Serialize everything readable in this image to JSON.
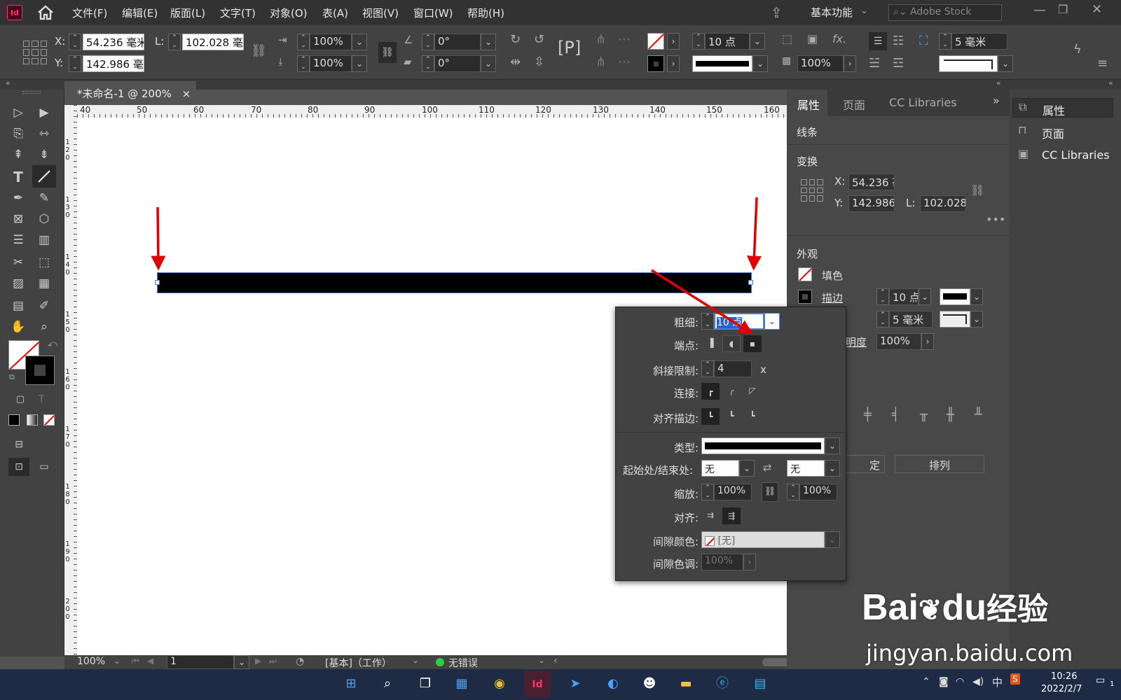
{
  "menubar": {
    "app_icon": "Id",
    "items": [
      "文件(F)",
      "编辑(E)",
      "版面(L)",
      "文字(T)",
      "对象(O)",
      "表(A)",
      "视图(V)",
      "窗口(W)",
      "帮助(H)"
    ],
    "workspace": "基本功能",
    "search_placeholder": "Adobe Stock"
  },
  "control": {
    "x_label": "X:",
    "x_value": "54.236 毫米",
    "y_label": "Y:",
    "y_value": "142.986 毫",
    "l_label": "L:",
    "l_value": "102.028 毫",
    "scale_x": "100%",
    "scale_y": "100%",
    "rotate": "0°",
    "shear": "0°",
    "stroke_weight": "10 点",
    "opacity": "100%",
    "offset": "5 毫米"
  },
  "doc_tab": {
    "title": "*未命名-1 @ 200%",
    "close": "×"
  },
  "ruler": {
    "h_ticks": [
      "40",
      "50",
      "60",
      "70",
      "80",
      "90",
      "100",
      "110",
      "120",
      "130",
      "140",
      "150",
      "160"
    ],
    "v_ticks": [
      "120",
      "130",
      "140",
      "150",
      "160",
      "170",
      "180",
      "190",
      "200"
    ]
  },
  "status": {
    "zoom": "100%",
    "page": "1",
    "style": "[基本]（工作）",
    "preflight": "无错误"
  },
  "props_panel": {
    "tabs": [
      "属性",
      "页面",
      "CC Libraries"
    ],
    "object_type": "线条",
    "transform_title": "变换",
    "x_label": "X:",
    "x_value": "54.236 毫",
    "y_label": "Y:",
    "y_value": "142.986",
    "l_label": "L:",
    "l_value": "102.028",
    "appearance_title": "外观",
    "fill_label": "填色",
    "stroke_label": "描边",
    "stroke_weight": "10 点",
    "offset": "5 毫米",
    "opacity_label_part": "明度",
    "opacity_value": "100%",
    "arrange_button": "排列",
    "partial_button": "定"
  },
  "far_panel": {
    "items": [
      "属性",
      "页面",
      "CC Libraries"
    ]
  },
  "stroke_popup": {
    "weight_label": "粗细:",
    "weight_value": "10 点",
    "cap_label": "端点:",
    "miter_label": "斜接限制:",
    "miter_value": "4",
    "miter_unit": "x",
    "join_label": "连接:",
    "align_label": "对齐描边:",
    "type_label": "类型:",
    "start_end_label": "起始处/结束处:",
    "start_value": "无",
    "end_value": "无",
    "scale_label": "缩放:",
    "scale_start": "100%",
    "scale_end": "100%",
    "arrow_align_label": "对齐:",
    "gap_color_label": "间隙颜色:",
    "gap_color_value": "[无]",
    "gap_tint_label": "间隙色调:",
    "gap_tint_value": "100%"
  },
  "taskbar": {
    "time": "10:26",
    "date": "2022/2/7",
    "ime": "中",
    "notification_count": "1"
  },
  "watermark": {
    "brand": "Bai",
    "brand2": "du",
    "suffix": "经验",
    "url": "jingyan.baidu.com"
  },
  "colors": {
    "accent": "#ff3366",
    "annotation_arrow": "#e00000",
    "selection": "#4a7fd8"
  }
}
